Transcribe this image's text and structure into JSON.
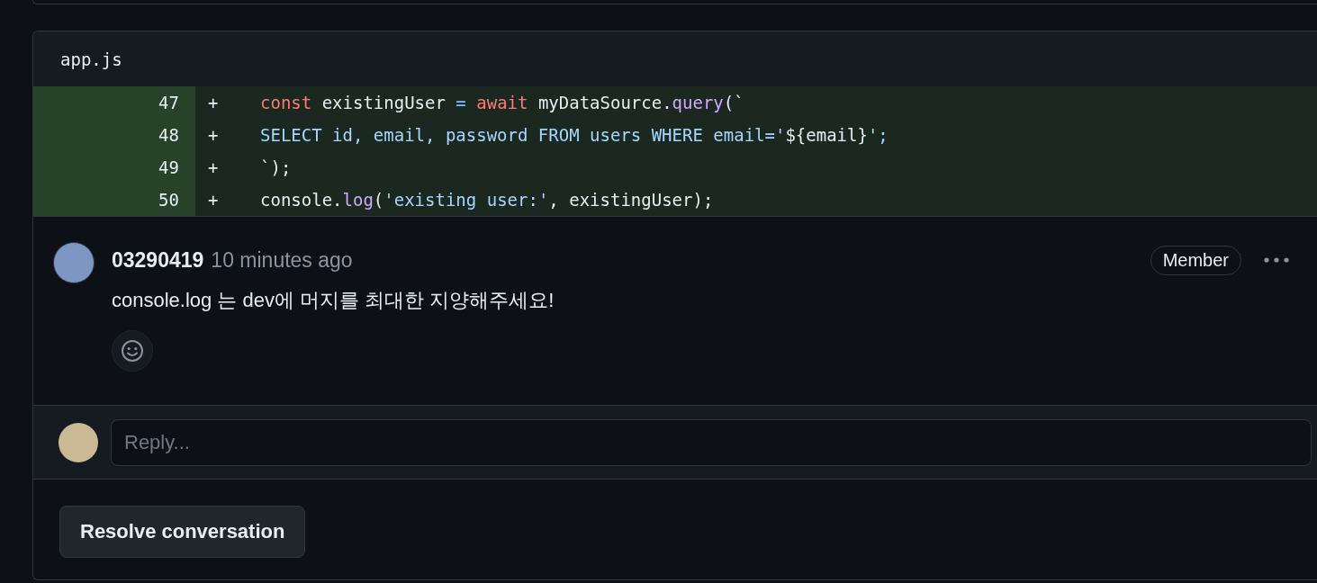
{
  "file": {
    "name": "app.js"
  },
  "diff_lines": [
    {
      "number": "47",
      "sign": "+",
      "tokens": [
        {
          "kind": "keyword",
          "text": "const"
        },
        {
          "kind": "plain",
          "text": " existingUser "
        },
        {
          "kind": "operator",
          "text": "= "
        },
        {
          "kind": "keyword",
          "text": "await"
        },
        {
          "kind": "plain",
          "text": " myDataSource."
        },
        {
          "kind": "function",
          "text": "query"
        },
        {
          "kind": "plain",
          "text": "(`"
        }
      ]
    },
    {
      "number": "48",
      "sign": "+",
      "tokens": [
        {
          "kind": "string",
          "text": "SELECT id, email, password FROM users WHERE email='"
        },
        {
          "kind": "plain",
          "text": "${email}"
        },
        {
          "kind": "string",
          "text": "';"
        }
      ]
    },
    {
      "number": "49",
      "sign": "+",
      "tokens": [
        {
          "kind": "plain",
          "text": "`);"
        }
      ]
    },
    {
      "number": "50",
      "sign": "+",
      "tokens": [
        {
          "kind": "plain",
          "text": "console."
        },
        {
          "kind": "function",
          "text": "log"
        },
        {
          "kind": "plain",
          "text": "("
        },
        {
          "kind": "string",
          "text": "'existing user:'"
        },
        {
          "kind": "plain",
          "text": ", existingUser);"
        }
      ]
    }
  ],
  "comment": {
    "author": "03290419",
    "time": "10 minutes ago",
    "badge": "Member",
    "body": "console.log 는 dev에 머지를 최대한 지양해주세요!"
  },
  "reply": {
    "placeholder": "Reply..."
  },
  "resolve_button": "Resolve conversation"
}
